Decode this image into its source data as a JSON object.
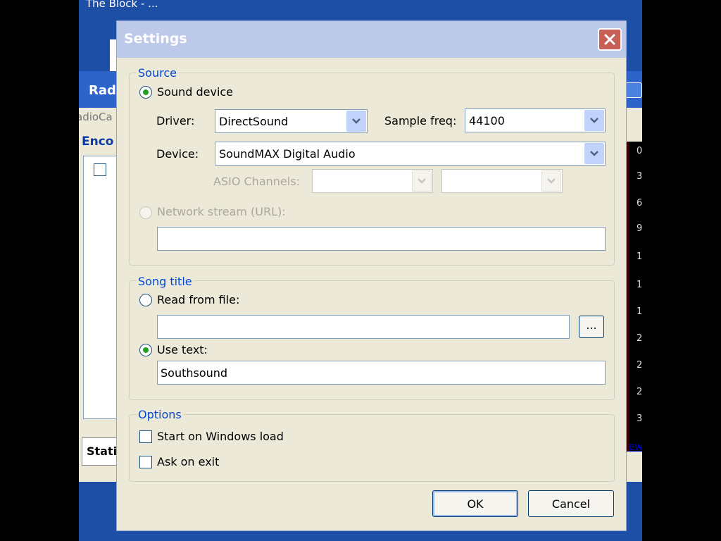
{
  "background": {
    "title": "The Block - ...",
    "window_title": "Rad",
    "window_subtitle": "adioCa",
    "encoders_label": "Enco",
    "stations_tab": "Stati",
    "view_link": "ew",
    "meter_ticks": [
      "0",
      "3",
      "6",
      "9",
      "1",
      "1",
      "1",
      "2",
      "2",
      "2",
      "3"
    ]
  },
  "dialog": {
    "title": "Settings",
    "source": {
      "label": "Source",
      "sound_device_label": "Sound device",
      "driver_label": "Driver:",
      "driver_value": "DirectSound",
      "sample_freq_label": "Sample freq:",
      "sample_freq_value": "44100",
      "device_label": "Device:",
      "device_value": "SoundMAX Digital Audio",
      "asio_label": "ASIO Channels:",
      "network_label": "Network stream (URL):",
      "network_value": ""
    },
    "song_title": {
      "label": "Song title",
      "read_from_file_label": "Read from file:",
      "file_value": "",
      "browse_label": "...",
      "use_text_label": "Use text:",
      "text_value": "Southsound"
    },
    "options": {
      "label": "Options",
      "start_on_load_label": "Start on Windows load",
      "ask_on_exit_label": "Ask on exit"
    },
    "ok_label": "OK",
    "cancel_label": "Cancel"
  },
  "colors": {
    "desktop": "#1E4FA6",
    "dialog_bg": "#ECE9D8",
    "group_label": "#0046D5",
    "radio_dot": "#21A121",
    "close_button": "#C75F56"
  }
}
